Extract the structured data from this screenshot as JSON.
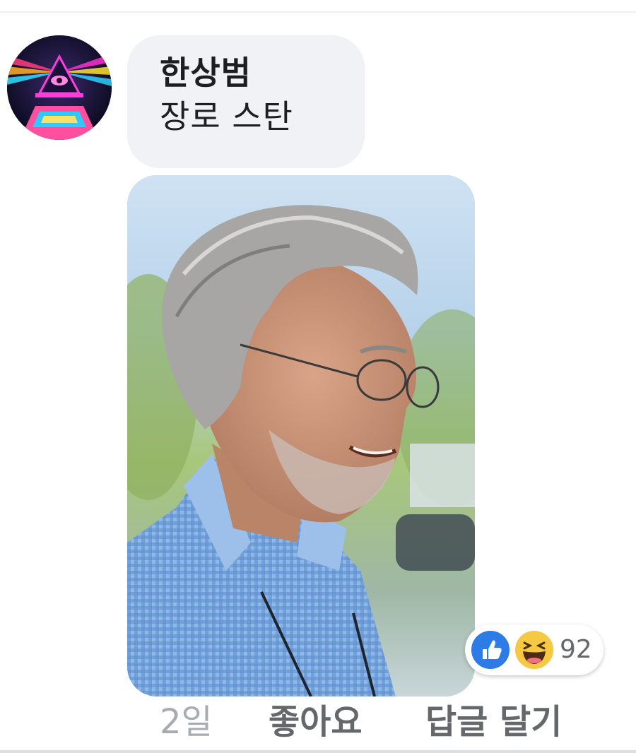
{
  "comment": {
    "author": "한상범",
    "text": "장로 스탄",
    "avatar_icon": "avatar-image"
  },
  "photo": {
    "icon": "photo-attachment"
  },
  "reactions": {
    "icons": [
      "like-icon",
      "haha-icon"
    ],
    "count": "92",
    "like_color": "#2d7be6",
    "haha_color": "#f7c843"
  },
  "actions": {
    "time": "2일",
    "like": "좋아요",
    "reply": "답글 달기"
  }
}
